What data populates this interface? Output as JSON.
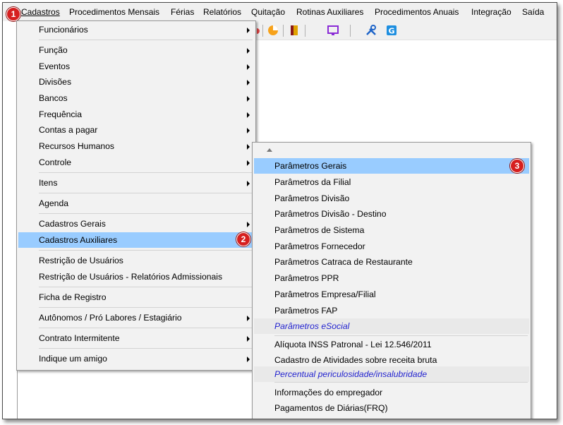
{
  "menubar": {
    "items": [
      "Cadastros",
      "Procedimentos Mensais",
      "Férias",
      "Relatórios",
      "Quitação",
      "Rotinas Auxiliares",
      "Procedimentos Anuais",
      "Integração",
      "Saída"
    ]
  },
  "toolbar": {
    "icons": [
      "chart-pie-icon",
      "book-icon",
      "monitor-icon",
      "tools-icon",
      "g-app-icon"
    ]
  },
  "cadastros_menu": {
    "items": [
      "Funcionários",
      "Função",
      "Eventos",
      "Divisões",
      "Bancos",
      "Frequência",
      "Contas a pagar",
      "Recursos Humanos",
      "Controle",
      "Itens",
      "Agenda",
      "Cadastros Gerais",
      "Cadastros Auxiliares",
      "Restrição de Usuários",
      "Restrição de Usuários - Relatórios Admissionais",
      "Ficha de Registro",
      "Autônomos / Pró Labores / Estagiário",
      "Contrato Intermitente",
      "Indique um amigo"
    ]
  },
  "aux_submenu": {
    "items": [
      "Parâmetros Gerais",
      "Parâmetros da Filial",
      "Parâmetros Divisão",
      "Parâmetros Divisão - Destino",
      "Parâmetros de Sistema",
      "Parâmetros Fornecedor",
      "Parâmetros Catraca de Restaurante",
      "Parâmetros PPR",
      "Parâmetros Empresa/Filial",
      "Parâmetros FAP",
      "Parâmetros eSocial",
      "Alíquota INSS Patronal - Lei 12.546/2011",
      "Cadastro de Atividades sobre receita bruta",
      "Percentual periculosidade/insalubridade",
      "Informações do empregador",
      "Pagamentos de Diárias(FRQ)"
    ]
  },
  "badges": [
    "1",
    "2",
    "3"
  ],
  "colors": {
    "highlight": "#99ccff",
    "italic_item": "#1f1fcf",
    "badge": "#d61f1f"
  }
}
